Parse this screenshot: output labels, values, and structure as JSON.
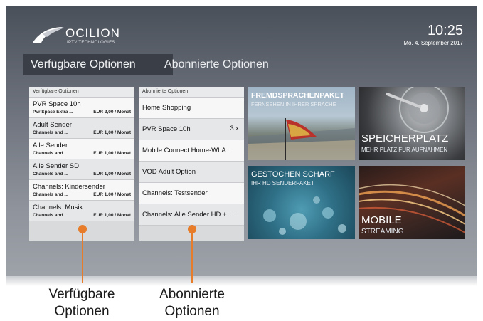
{
  "header": {
    "logo_text": "OCILION",
    "logo_subtext": "IPTV TECHNOLOGIES",
    "time": "10:25",
    "date": "Mo. 4. September 2017"
  },
  "tabs": [
    {
      "label": "Verfügbare Optionen",
      "active": true
    },
    {
      "label": "Abonnierte Optionen",
      "active": false
    }
  ],
  "available_panel": {
    "heading": "Verfügbare Optionen",
    "items": [
      {
        "title": "PVR Space 10h",
        "subtitle": "Pvr Space Extra ...",
        "price": "EUR 2,00 / Monat"
      },
      {
        "title": "Adult Sender",
        "subtitle": "Channels and ...",
        "price": "EUR 1,00 / Monat"
      },
      {
        "title": "Alle Sender",
        "subtitle": "Channels and ...",
        "price": "EUR 1,00 / Monat"
      },
      {
        "title": "Alle Sender SD",
        "subtitle": "Channels and ...",
        "price": "EUR 1,00 / Monat"
      },
      {
        "title": "Channels: Kindersender",
        "subtitle": "Channels and ...",
        "price": "EUR 1,00 / Monat"
      },
      {
        "title": "Channels: Musik",
        "subtitle": "Channels and ...",
        "price": "EUR 1,00 / Monat"
      }
    ]
  },
  "subscribed_panel": {
    "heading": "Abonnierte Optionen",
    "items": [
      {
        "title": "Home Shopping",
        "count": ""
      },
      {
        "title": "PVR Space 10h",
        "count": "3 x"
      },
      {
        "title": "Mobile Connect Home-WLA...",
        "count": ""
      },
      {
        "title": "VOD Adult Option",
        "count": ""
      },
      {
        "title": "Channels: Testsender",
        "count": ""
      },
      {
        "title": "Channels: Alle Sender HD + ...",
        "count": ""
      }
    ]
  },
  "promo_tiles": [
    {
      "title": "FREMDSPRACHENPAKET",
      "subtitle": "FERNSEHEN IN IHRER SPRACHE"
    },
    {
      "title": "SPEICHERPLATZ",
      "subtitle": "MEHR PLATZ FÜR AUFNAHMEN"
    },
    {
      "title": "GESTOCHEN SCHARF",
      "subtitle": "IHR HD SENDERPAKET"
    },
    {
      "title": "MOBILE",
      "subtitle": "STREAMING"
    }
  ],
  "captions": {
    "left_line1": "Verfügbare",
    "left_line2": "Optionen",
    "right_line1": "Abonnierte",
    "right_line2": "Optionen"
  },
  "colors": {
    "accent": "#e77c2a",
    "active_tab": "#3a3f47"
  }
}
